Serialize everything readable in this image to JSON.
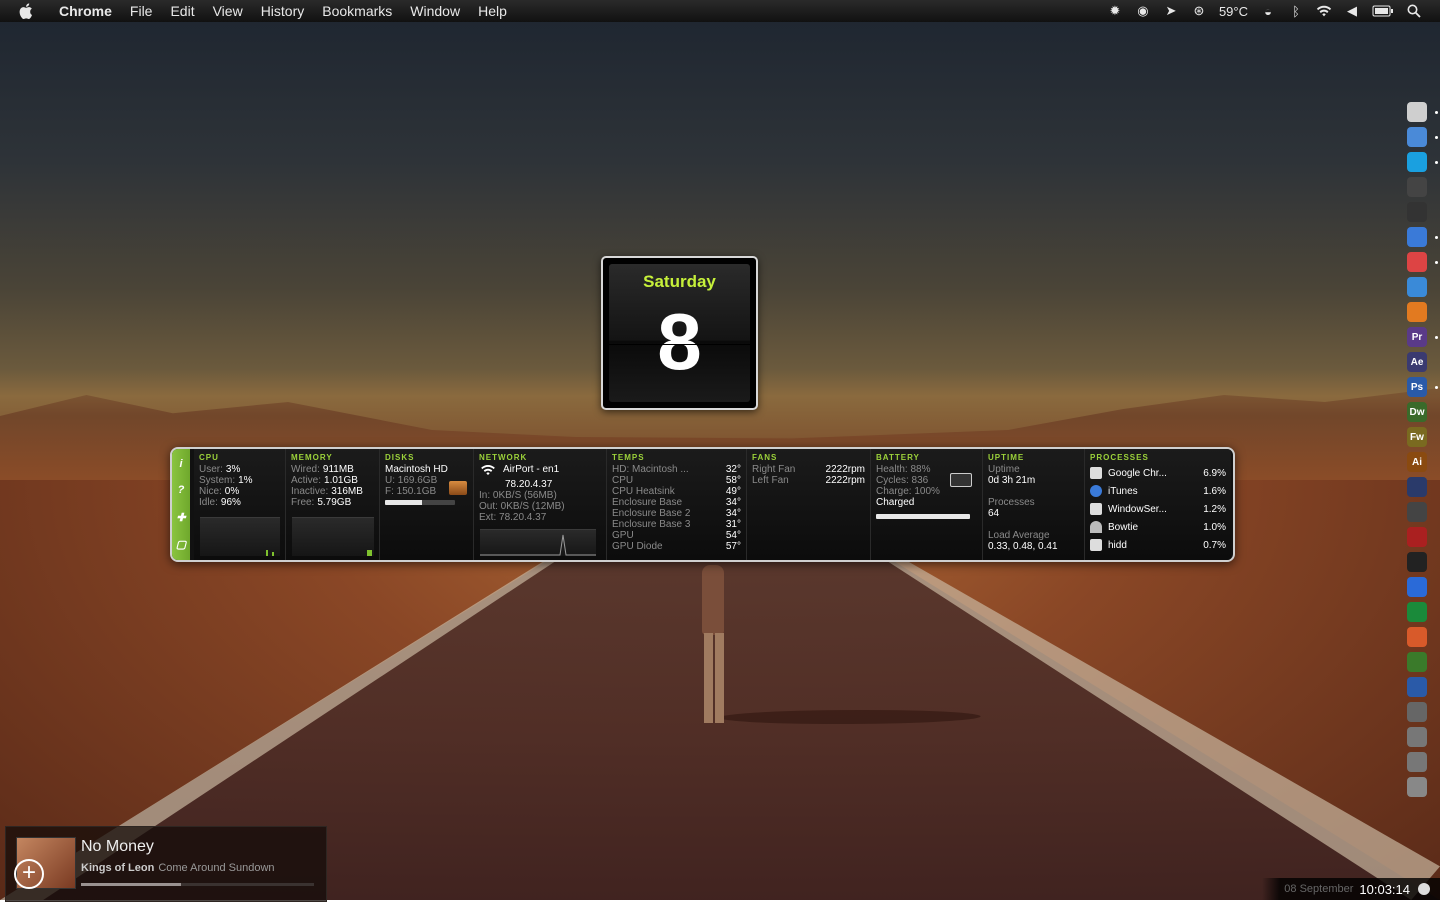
{
  "menubar": {
    "app": "Chrome",
    "items": [
      "File",
      "Edit",
      "View",
      "History",
      "Bookmarks",
      "Window",
      "Help"
    ],
    "temperature": "59°C"
  },
  "calendar": {
    "weekday": "Saturday",
    "day": "8"
  },
  "istat": {
    "cpu": {
      "title": "CPU",
      "user_k": "User:",
      "user": "3%",
      "system_k": "System:",
      "system": "1%",
      "nice_k": "Nice:",
      "nice": "0%",
      "idle_k": "Idle:",
      "idle": "96%"
    },
    "memory": {
      "title": "MEMORY",
      "wired_k": "Wired:",
      "wired": "911MB",
      "active_k": "Active:",
      "active": "1.01GB",
      "inactive_k": "Inactive:",
      "inactive": "316MB",
      "free_k": "Free:",
      "free": "5.79GB"
    },
    "disks": {
      "title": "DISKS",
      "name": "Macintosh HD",
      "used": "U: 169.6GB",
      "free": "F: 150.1GB",
      "used_fraction": 0.53
    },
    "network": {
      "title": "NETWORK",
      "iface": "AirPort - en1",
      "ip": "78.20.4.37",
      "in": "In: 0KB/S (56MB)",
      "out": "Out: 0KB/S (12MB)",
      "ext": "Ext: 78.20.4.37"
    },
    "temps": {
      "title": "TEMPS",
      "rows": [
        {
          "k": "HD: Macintosh ...",
          "v": "32°"
        },
        {
          "k": "CPU",
          "v": "58°"
        },
        {
          "k": "CPU Heatsink",
          "v": "49°"
        },
        {
          "k": "Enclosure Base",
          "v": "34°"
        },
        {
          "k": "Enclosure Base 2",
          "v": "34°"
        },
        {
          "k": "Enclosure Base 3",
          "v": "31°"
        },
        {
          "k": "GPU",
          "v": "54°"
        },
        {
          "k": "GPU Diode",
          "v": "57°"
        }
      ]
    },
    "fans": {
      "title": "FANS",
      "rows": [
        {
          "k": "Right Fan",
          "v": "2222rpm"
        },
        {
          "k": "Left Fan",
          "v": "2222rpm"
        }
      ]
    },
    "battery": {
      "title": "BATTERY",
      "health": "Health: 88%",
      "cycles": "Cycles: 836",
      "charge": "Charge: 100%",
      "status": "Charged",
      "level": 1.0
    },
    "uptime": {
      "title": "UPTIME",
      "label": "Uptime",
      "value": "0d 3h 21m",
      "proc_label": "Processes",
      "proc_value": "64",
      "load_label": "Load Average",
      "load_value": "0.33, 0.48, 0.41"
    },
    "processes": {
      "title": "PROCESSES",
      "rows": [
        {
          "name": "Google Chr...",
          "pct": "6.9%"
        },
        {
          "name": "iTunes",
          "pct": "1.6%"
        },
        {
          "name": "WindowSer...",
          "pct": "1.2%"
        },
        {
          "name": "Bowtie",
          "pct": "1.0%"
        },
        {
          "name": "hidd",
          "pct": "0.7%"
        }
      ]
    }
  },
  "dock": [
    "Finder",
    "Mail",
    "Skype",
    "Network",
    "Camera",
    "iTunes",
    "Chrome",
    "Safari",
    "Firefox",
    "Premiere",
    "After Effects",
    "Photoshop",
    "Dreamweaver",
    "Fireworks",
    "Illustrator",
    "QuickTime",
    "iMovie",
    "Lego",
    "Final Cut",
    "Word",
    "Excel",
    "PowerPoint",
    "Minecraft",
    "Xcode",
    "System Preferences",
    "Documents",
    "Downloads",
    "Trash"
  ],
  "music": {
    "title": "No Money",
    "artist": "Kings of Leon",
    "album": "Come Around Sundown",
    "progress": 0.43
  },
  "clock": {
    "date": "08 September",
    "time": "10:03:14"
  }
}
